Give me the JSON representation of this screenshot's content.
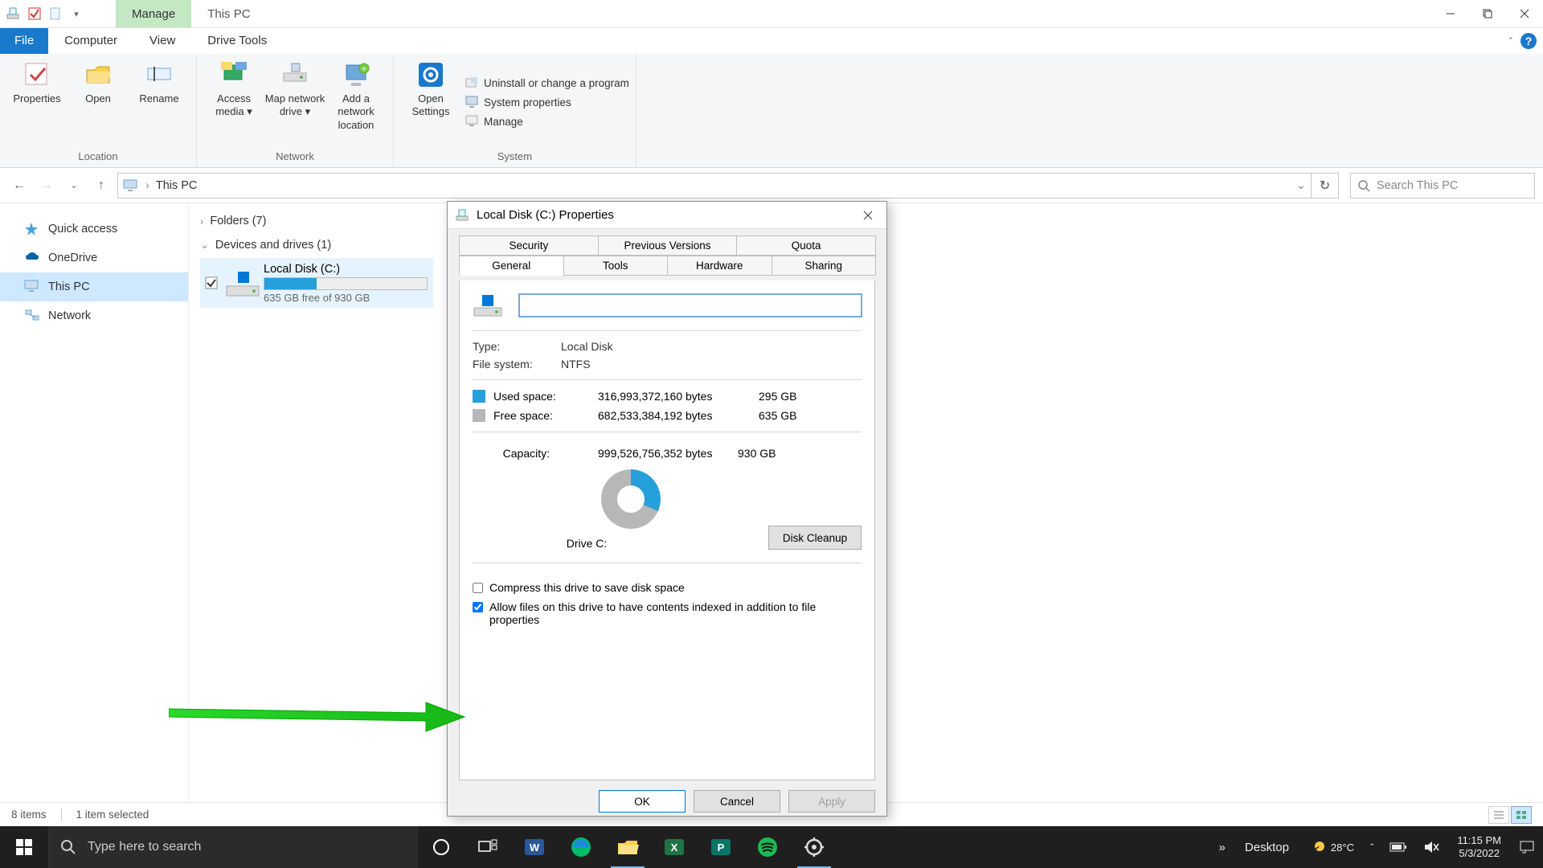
{
  "titlebar": {
    "tool_tab": "Manage",
    "location": "This PC"
  },
  "ribbon_tabs": {
    "file": "File",
    "computer": "Computer",
    "view": "View",
    "drivetools": "Drive Tools"
  },
  "ribbon": {
    "location": {
      "properties": "Properties",
      "open": "Open",
      "rename": "Rename",
      "group": "Location"
    },
    "network": {
      "access_media": "Access media",
      "map_drive": "Map network drive",
      "add_loc": "Add a network location",
      "group": "Network"
    },
    "system": {
      "open_settings": "Open Settings",
      "uninstall": "Uninstall or change a program",
      "sysprops": "System properties",
      "manage": "Manage",
      "group": "System"
    }
  },
  "addr": {
    "location": "This PC"
  },
  "search": {
    "placeholder": "Search This PC"
  },
  "sidebar": {
    "quick": "Quick access",
    "onedrive": "OneDrive",
    "thispc": "This PC",
    "network": "Network"
  },
  "content": {
    "folders_head": "Folders (7)",
    "drives_head": "Devices and drives (1)",
    "drive": {
      "name": "Local Disk (C:)",
      "free": "635 GB free of 930 GB"
    }
  },
  "dialog": {
    "title": "Local Disk (C:) Properties",
    "tabs": {
      "security": "Security",
      "prev": "Previous Versions",
      "quota": "Quota",
      "general": "General",
      "tools": "Tools",
      "hardware": "Hardware",
      "sharing": "Sharing"
    },
    "name_value": "",
    "type_label": "Type:",
    "type_value": "Local Disk",
    "fs_label": "File system:",
    "fs_value": "NTFS",
    "used_label": "Used space:",
    "used_bytes": "316,993,372,160 bytes",
    "used_gb": "295 GB",
    "free_label": "Free space:",
    "free_bytes": "682,533,384,192 bytes",
    "free_gb": "635 GB",
    "cap_label": "Capacity:",
    "cap_bytes": "999,526,756,352 bytes",
    "cap_gb": "930 GB",
    "drive_label": "Drive C:",
    "cleanup": "Disk Cleanup",
    "compress": "Compress this drive to save disk space",
    "index": "Allow files on this drive to have contents indexed in addition to file properties",
    "ok": "OK",
    "cancel": "Cancel",
    "apply": "Apply"
  },
  "statusbar": {
    "items": "8 items",
    "selected": "1 item selected"
  },
  "taskbar": {
    "search_placeholder": "Type here to search",
    "desktop": "Desktop",
    "temp": "28°C",
    "time": "11:15 PM",
    "date": "5/3/2022"
  }
}
